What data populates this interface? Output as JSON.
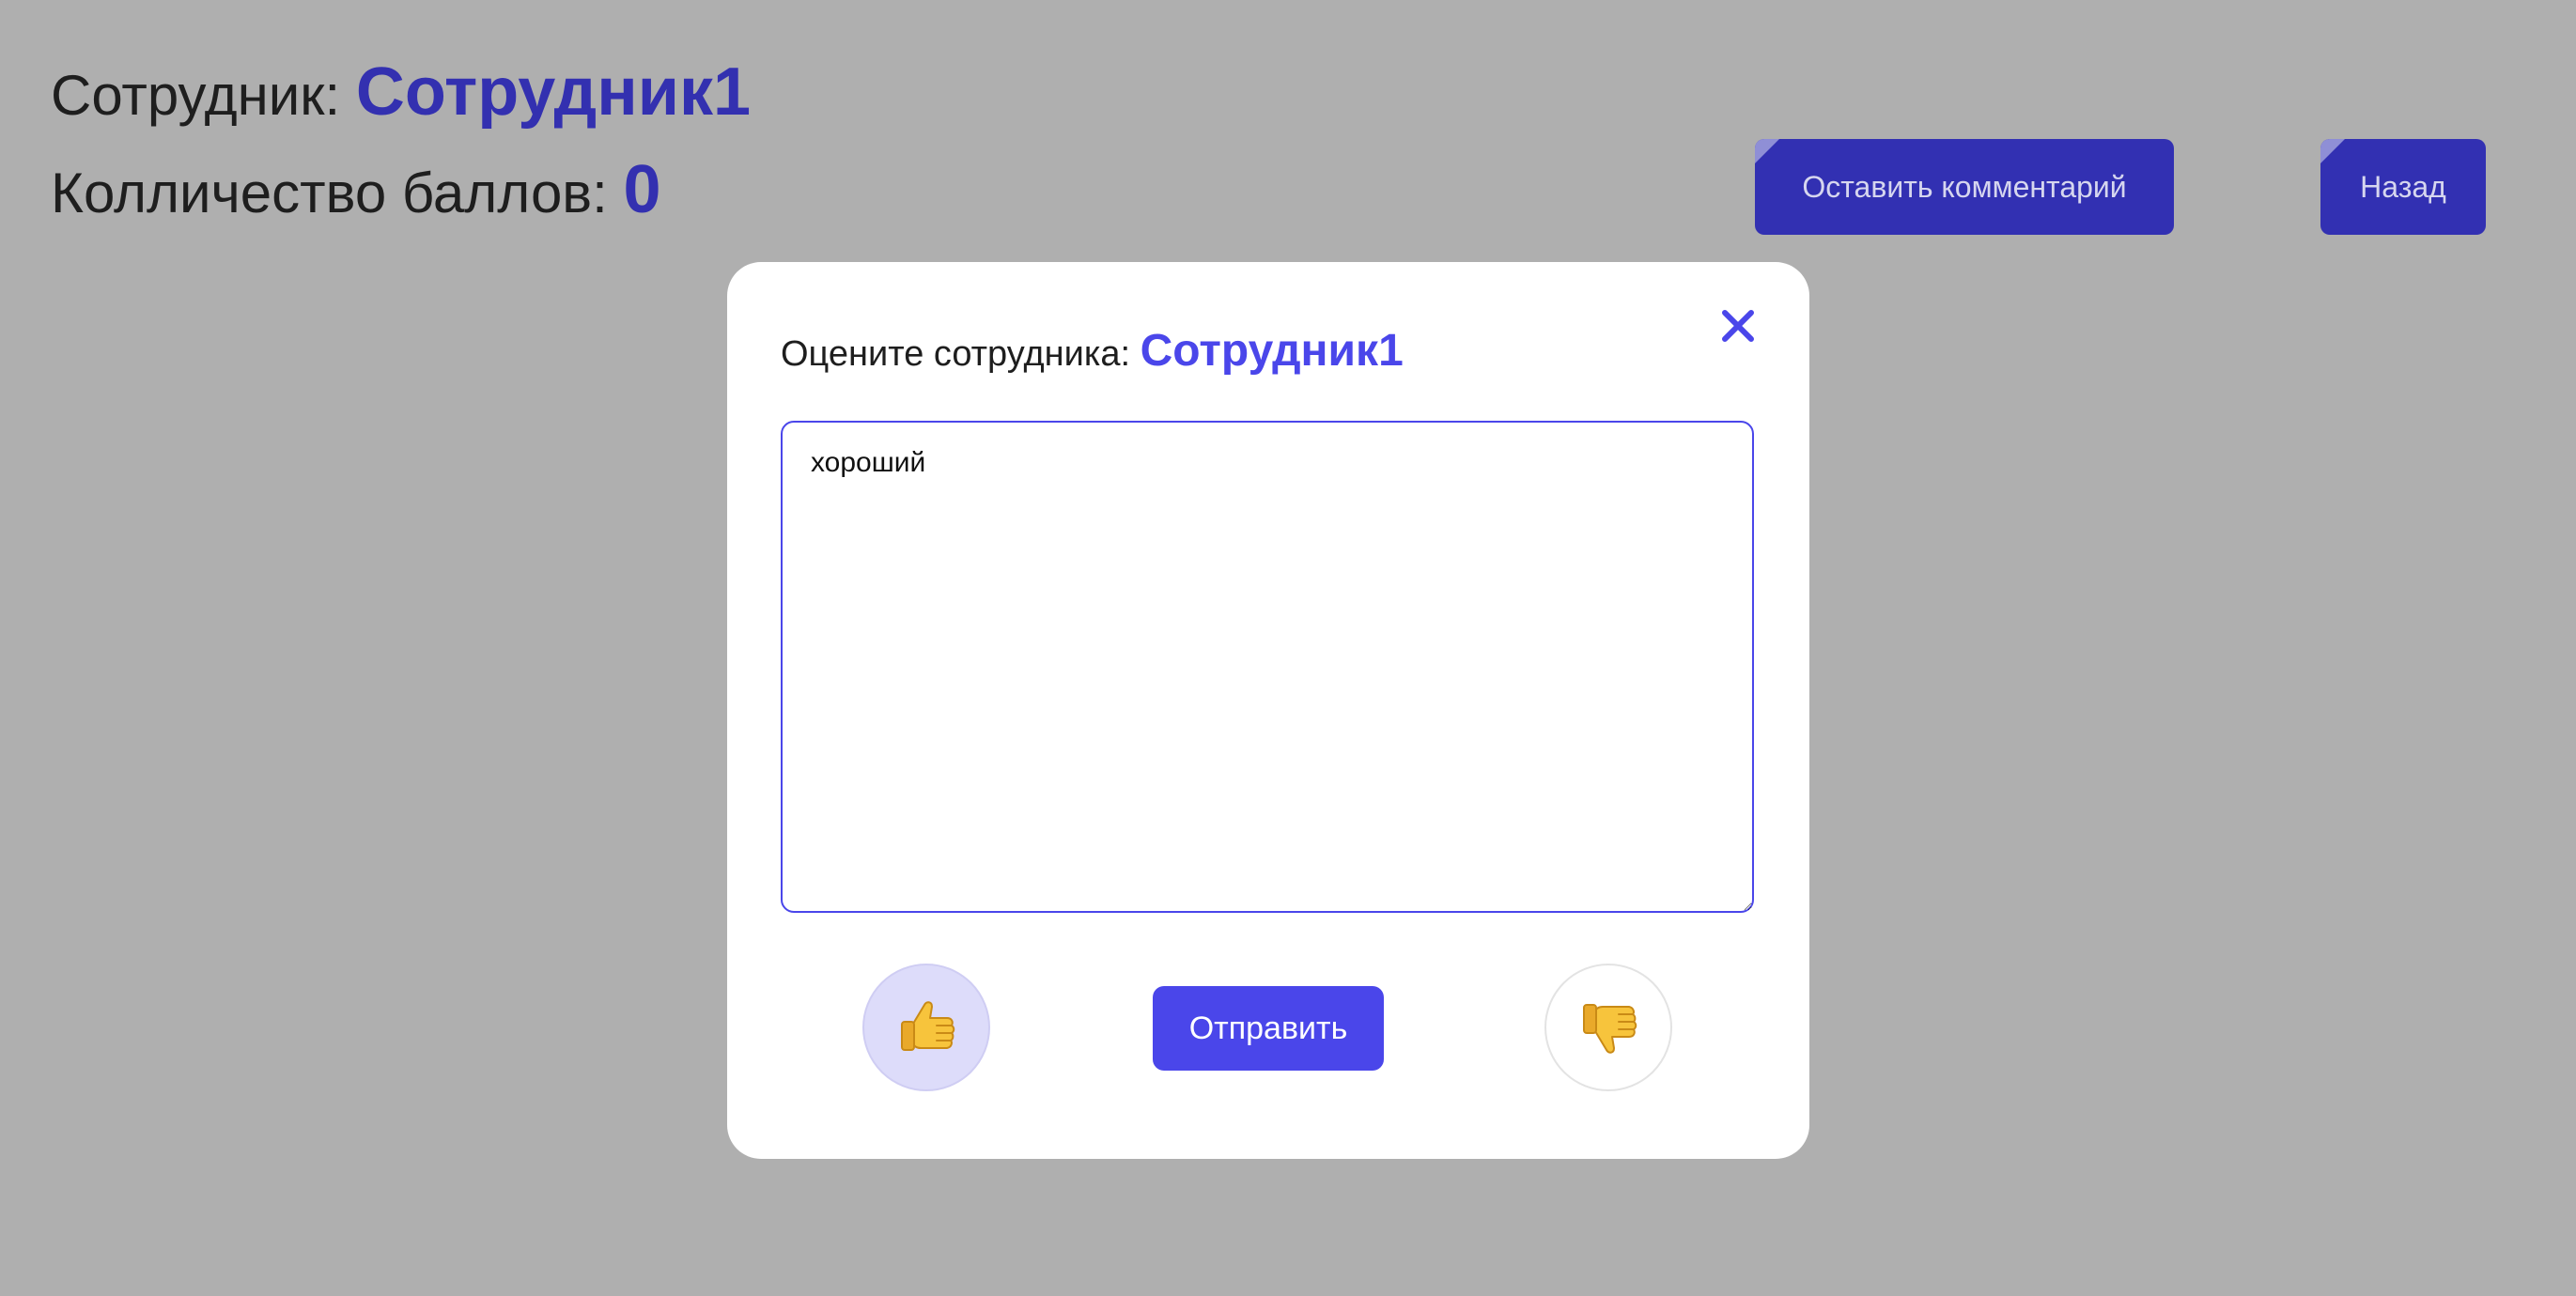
{
  "header": {
    "employee_label": "Сотрудник:",
    "employee_name": "Сотрудник1",
    "points_label": "Колличество баллов:",
    "points_value": "0"
  },
  "toolbar": {
    "comment_label": "Оставить комментарий",
    "back_label": "Назад"
  },
  "modal": {
    "title_label": "Оцените сотрудника:",
    "employee_name": "Сотрудник1",
    "comment_value": "хороший",
    "submit_label": "Отправить",
    "like_icon": "thumbs-up-icon",
    "dislike_icon": "thumbs-down-icon",
    "close_icon": "close-icon",
    "like_selected": true
  },
  "colors": {
    "background": "#afafaf",
    "accent": "#4a46ea",
    "header_accent": "#3230b2",
    "like_selected_bg": "#dddcfa"
  }
}
